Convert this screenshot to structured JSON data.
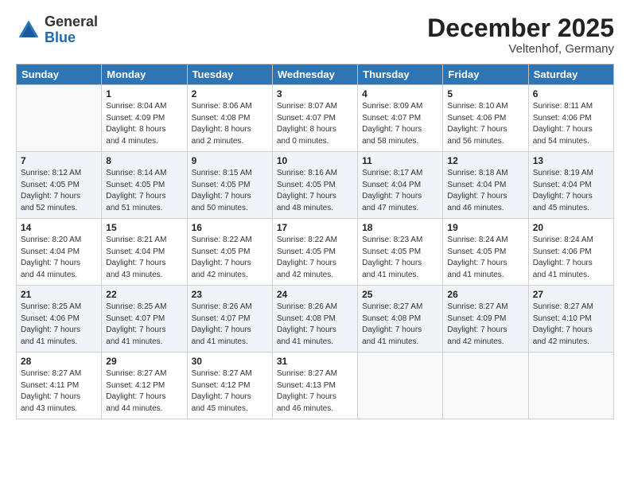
{
  "header": {
    "logo_general": "General",
    "logo_blue": "Blue",
    "title": "December 2025",
    "subtitle": "Veltenhof, Germany"
  },
  "calendar": {
    "days_of_week": [
      "Sunday",
      "Monday",
      "Tuesday",
      "Wednesday",
      "Thursday",
      "Friday",
      "Saturday"
    ],
    "weeks": [
      [
        {
          "day": "",
          "info": ""
        },
        {
          "day": "1",
          "info": "Sunrise: 8:04 AM\nSunset: 4:09 PM\nDaylight: 8 hours\nand 4 minutes."
        },
        {
          "day": "2",
          "info": "Sunrise: 8:06 AM\nSunset: 4:08 PM\nDaylight: 8 hours\nand 2 minutes."
        },
        {
          "day": "3",
          "info": "Sunrise: 8:07 AM\nSunset: 4:07 PM\nDaylight: 8 hours\nand 0 minutes."
        },
        {
          "day": "4",
          "info": "Sunrise: 8:09 AM\nSunset: 4:07 PM\nDaylight: 7 hours\nand 58 minutes."
        },
        {
          "day": "5",
          "info": "Sunrise: 8:10 AM\nSunset: 4:06 PM\nDaylight: 7 hours\nand 56 minutes."
        },
        {
          "day": "6",
          "info": "Sunrise: 8:11 AM\nSunset: 4:06 PM\nDaylight: 7 hours\nand 54 minutes."
        }
      ],
      [
        {
          "day": "7",
          "info": "Sunrise: 8:12 AM\nSunset: 4:05 PM\nDaylight: 7 hours\nand 52 minutes."
        },
        {
          "day": "8",
          "info": "Sunrise: 8:14 AM\nSunset: 4:05 PM\nDaylight: 7 hours\nand 51 minutes."
        },
        {
          "day": "9",
          "info": "Sunrise: 8:15 AM\nSunset: 4:05 PM\nDaylight: 7 hours\nand 50 minutes."
        },
        {
          "day": "10",
          "info": "Sunrise: 8:16 AM\nSunset: 4:05 PM\nDaylight: 7 hours\nand 48 minutes."
        },
        {
          "day": "11",
          "info": "Sunrise: 8:17 AM\nSunset: 4:04 PM\nDaylight: 7 hours\nand 47 minutes."
        },
        {
          "day": "12",
          "info": "Sunrise: 8:18 AM\nSunset: 4:04 PM\nDaylight: 7 hours\nand 46 minutes."
        },
        {
          "day": "13",
          "info": "Sunrise: 8:19 AM\nSunset: 4:04 PM\nDaylight: 7 hours\nand 45 minutes."
        }
      ],
      [
        {
          "day": "14",
          "info": "Sunrise: 8:20 AM\nSunset: 4:04 PM\nDaylight: 7 hours\nand 44 minutes."
        },
        {
          "day": "15",
          "info": "Sunrise: 8:21 AM\nSunset: 4:04 PM\nDaylight: 7 hours\nand 43 minutes."
        },
        {
          "day": "16",
          "info": "Sunrise: 8:22 AM\nSunset: 4:05 PM\nDaylight: 7 hours\nand 42 minutes."
        },
        {
          "day": "17",
          "info": "Sunrise: 8:22 AM\nSunset: 4:05 PM\nDaylight: 7 hours\nand 42 minutes."
        },
        {
          "day": "18",
          "info": "Sunrise: 8:23 AM\nSunset: 4:05 PM\nDaylight: 7 hours\nand 41 minutes."
        },
        {
          "day": "19",
          "info": "Sunrise: 8:24 AM\nSunset: 4:05 PM\nDaylight: 7 hours\nand 41 minutes."
        },
        {
          "day": "20",
          "info": "Sunrise: 8:24 AM\nSunset: 4:06 PM\nDaylight: 7 hours\nand 41 minutes."
        }
      ],
      [
        {
          "day": "21",
          "info": "Sunrise: 8:25 AM\nSunset: 4:06 PM\nDaylight: 7 hours\nand 41 minutes."
        },
        {
          "day": "22",
          "info": "Sunrise: 8:25 AM\nSunset: 4:07 PM\nDaylight: 7 hours\nand 41 minutes."
        },
        {
          "day": "23",
          "info": "Sunrise: 8:26 AM\nSunset: 4:07 PM\nDaylight: 7 hours\nand 41 minutes."
        },
        {
          "day": "24",
          "info": "Sunrise: 8:26 AM\nSunset: 4:08 PM\nDaylight: 7 hours\nand 41 minutes."
        },
        {
          "day": "25",
          "info": "Sunrise: 8:27 AM\nSunset: 4:08 PM\nDaylight: 7 hours\nand 41 minutes."
        },
        {
          "day": "26",
          "info": "Sunrise: 8:27 AM\nSunset: 4:09 PM\nDaylight: 7 hours\nand 42 minutes."
        },
        {
          "day": "27",
          "info": "Sunrise: 8:27 AM\nSunset: 4:10 PM\nDaylight: 7 hours\nand 42 minutes."
        }
      ],
      [
        {
          "day": "28",
          "info": "Sunrise: 8:27 AM\nSunset: 4:11 PM\nDaylight: 7 hours\nand 43 minutes."
        },
        {
          "day": "29",
          "info": "Sunrise: 8:27 AM\nSunset: 4:12 PM\nDaylight: 7 hours\nand 44 minutes."
        },
        {
          "day": "30",
          "info": "Sunrise: 8:27 AM\nSunset: 4:12 PM\nDaylight: 7 hours\nand 45 minutes."
        },
        {
          "day": "31",
          "info": "Sunrise: 8:27 AM\nSunset: 4:13 PM\nDaylight: 7 hours\nand 46 minutes."
        },
        {
          "day": "",
          "info": ""
        },
        {
          "day": "",
          "info": ""
        },
        {
          "day": "",
          "info": ""
        }
      ]
    ]
  }
}
